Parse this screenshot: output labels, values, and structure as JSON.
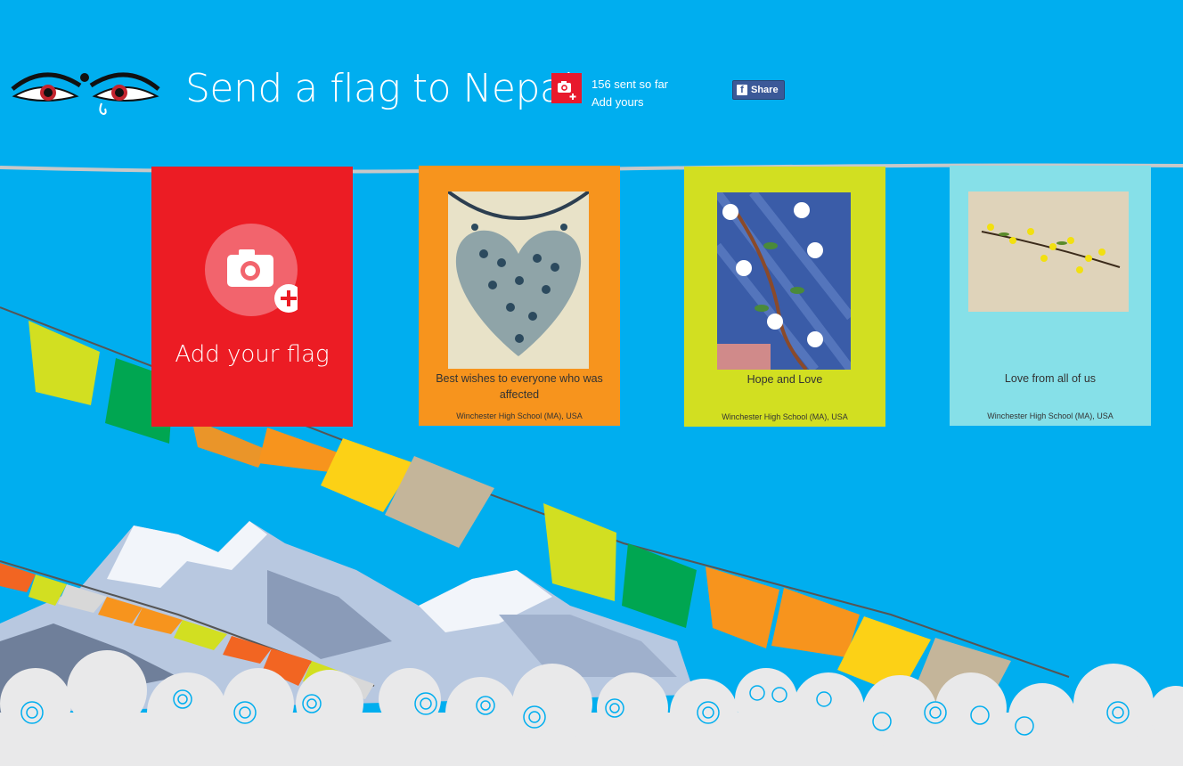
{
  "header": {
    "title": "Send a flag to Nepal",
    "counter_text": "156 sent so far",
    "add_link": "Add yours",
    "share_label": "Share"
  },
  "flags": [
    {
      "kind": "add",
      "label": "Add your flag"
    },
    {
      "message": "Best wishes to everyone who was affected",
      "location": "Winchester High School (MA), USA"
    },
    {
      "message": "Hope and Love",
      "location": "Winchester High School (MA), USA"
    },
    {
      "message": "Love from all of us",
      "location": "Winchester High School (MA), USA"
    }
  ],
  "icons": {
    "logo": "buddha-eyes-icon",
    "counter": "camera-plus-icon",
    "share": "facebook-icon",
    "add_flag": "camera-plus-icon"
  },
  "colors": {
    "sky": "#00aeef",
    "red": "#ec1c24",
    "orange": "#f7941d",
    "lime": "#d2df21",
    "cyan": "#86e0e8",
    "facebook": "#3b5998"
  }
}
